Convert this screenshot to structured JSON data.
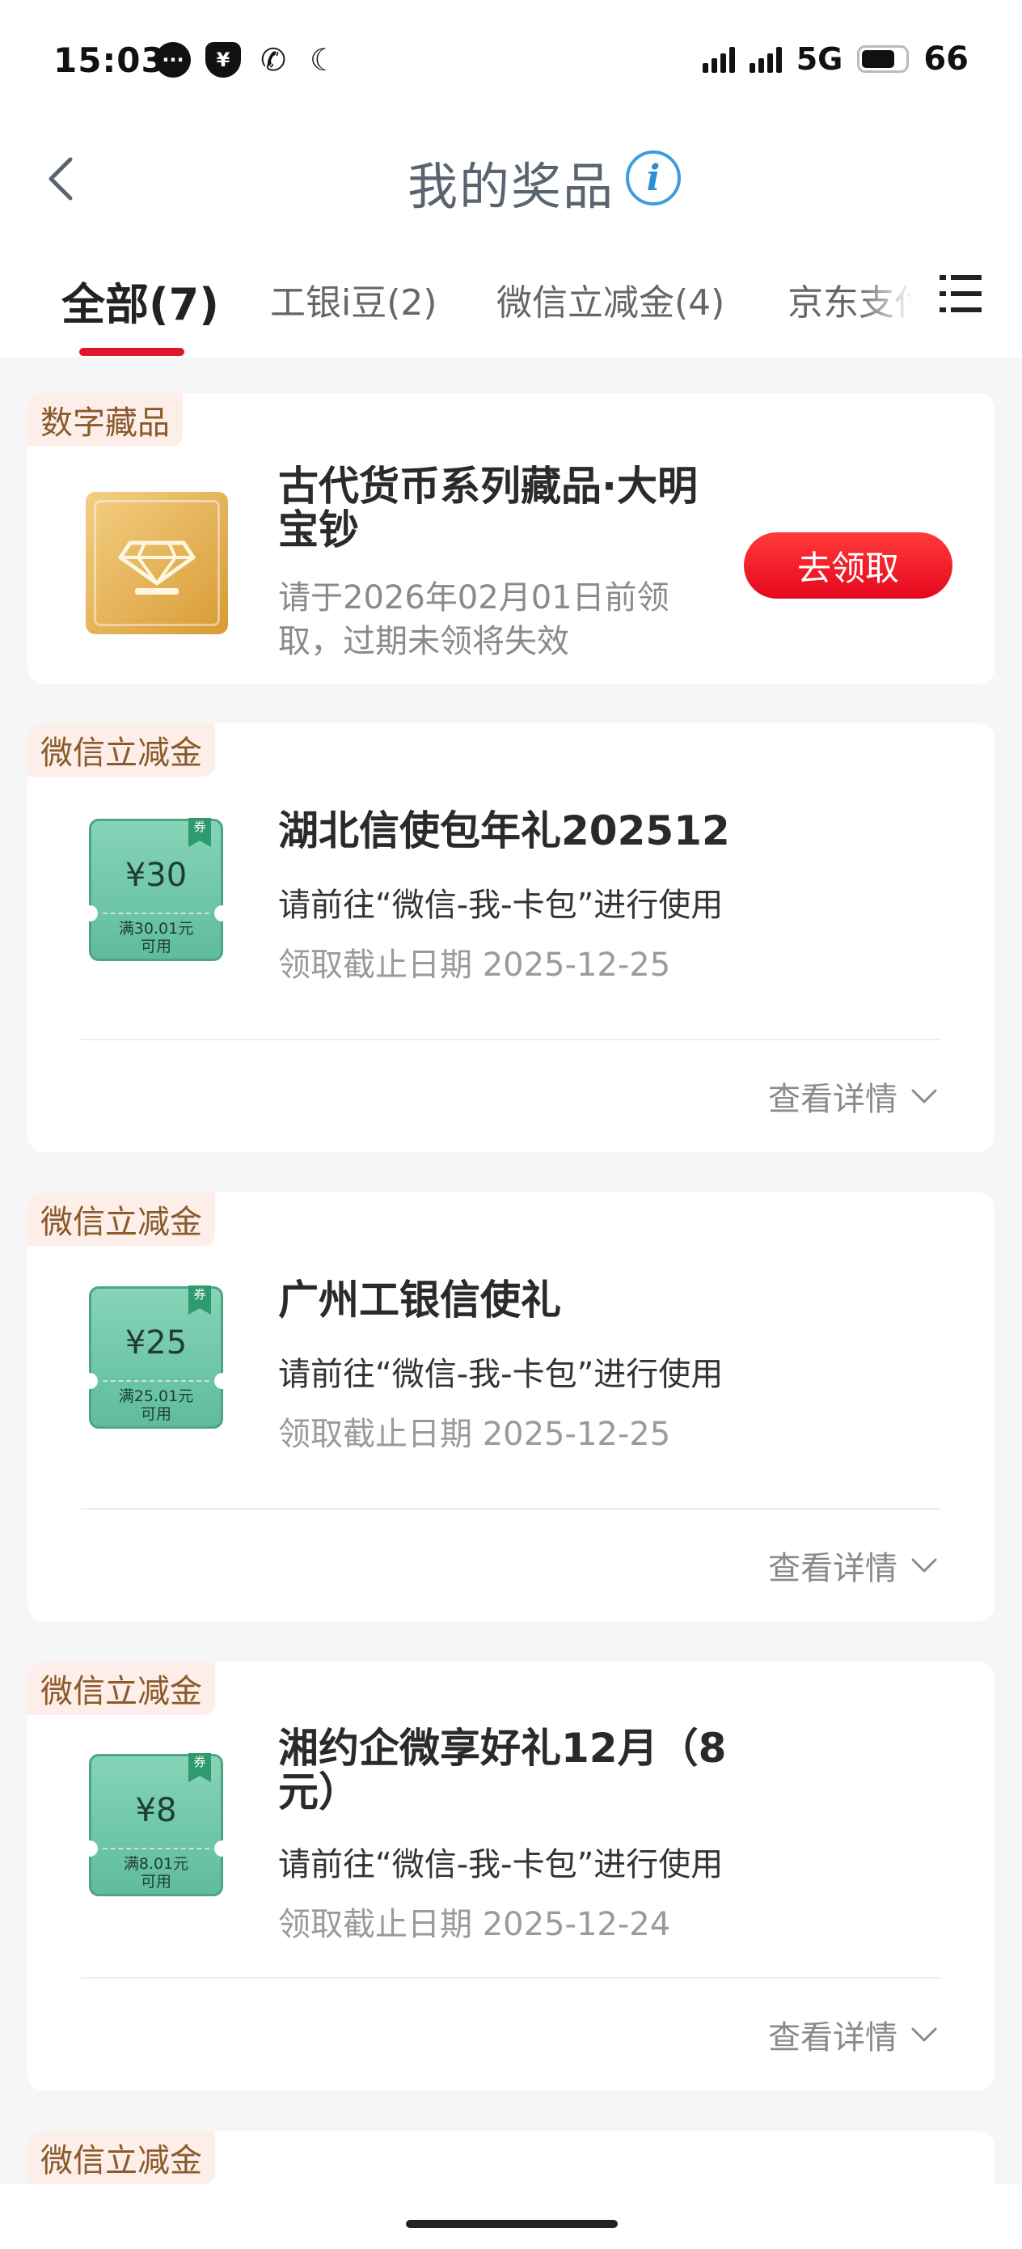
{
  "status_bar": {
    "time": "15:03",
    "network": "5G",
    "battery": "66",
    "icons": [
      "message-icon",
      "shield-yen-icon",
      "phone-wifi-icon",
      "moon-icon"
    ]
  },
  "header": {
    "title": "我的奖品",
    "info_glyph": "i"
  },
  "tabs": [
    {
      "label": "全部(7)",
      "active": true
    },
    {
      "label": "工银i豆(2)",
      "active": false
    },
    {
      "label": "微信立减金(4)",
      "active": false
    },
    {
      "label": "京东支付",
      "active": false
    }
  ],
  "colors": {
    "accent_red": "#e0162b",
    "badge_bg": "#fdeeea",
    "coupon_green": "#5fbc9c"
  },
  "cards": [
    {
      "badge": "数字藏品",
      "title": "古代货币系列藏品·大明宝钞",
      "sub": "请于2026年02月01日前领取，过期未领将失效",
      "action": "去领取"
    },
    {
      "badge": "微信立减金",
      "title": "湖北信使包年礼202512",
      "sub": "请前往“微信-我-卡包”进行使用",
      "date": "领取截止日期 2025-12-25",
      "detail": "查看详情",
      "coupon": {
        "amount": "¥30",
        "cond_line1": "满30.01元",
        "cond_line2": "可用",
        "tag": "券"
      }
    },
    {
      "badge": "微信立减金",
      "title": "广州工银信使礼",
      "sub": "请前往“微信-我-卡包”进行使用",
      "date": "领取截止日期 2025-12-25",
      "detail": "查看详情",
      "coupon": {
        "amount": "¥25",
        "cond_line1": "满25.01元",
        "cond_line2": "可用",
        "tag": "券"
      }
    },
    {
      "badge": "微信立减金",
      "title": "湘约企微享好礼12月（8元）",
      "sub": "请前往“微信-我-卡包”进行使用",
      "date": "领取截止日期 2025-12-24",
      "detail": "查看详情",
      "coupon": {
        "amount": "¥8",
        "cond_line1": "满8.01元",
        "cond_line2": "可用",
        "tag": "券"
      }
    },
    {
      "badge": "微信立减金"
    }
  ]
}
